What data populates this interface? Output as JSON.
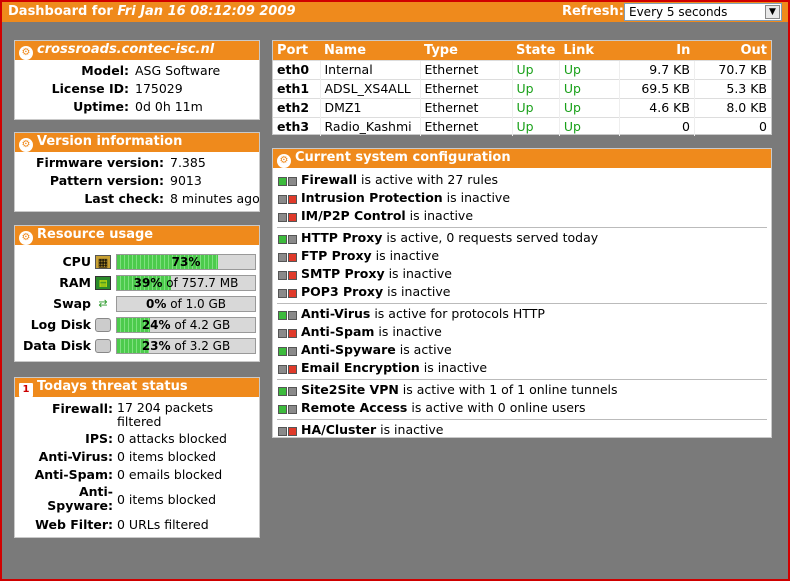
{
  "header": {
    "title_prefix": "Dashboard for",
    "title_date": "Fri Jan 16 08:12:09 2009",
    "refresh_label": "Refresh:",
    "refresh_value": "Every 5 seconds"
  },
  "host": {
    "name": "crossroads.contec-isc.nl",
    "rows": [
      {
        "k": "Model:",
        "v": "ASG Software"
      },
      {
        "k": "License ID:",
        "v": "175029"
      },
      {
        "k": "Uptime:",
        "v": "0d 0h 11m"
      }
    ]
  },
  "version": {
    "title": "Version information",
    "rows": [
      {
        "k": "Firmware version:",
        "v": "7.385"
      },
      {
        "k": "Pattern version:",
        "v": "9013"
      },
      {
        "k": "Last check:",
        "v": "8 minutes ago"
      }
    ]
  },
  "resources": {
    "title": "Resource usage",
    "rows": [
      {
        "k": "CPU",
        "icon": "cpu-icon",
        "pct": 73,
        "label_pct": "73%",
        "label_of": ""
      },
      {
        "k": "RAM",
        "icon": "ram-icon",
        "pct": 39,
        "label_pct": "39%",
        "label_of": " of 757.7 MB"
      },
      {
        "k": "Swap",
        "icon": "swap-icon",
        "pct": 0,
        "label_pct": "0%",
        "label_of": " of 1.0 GB"
      },
      {
        "k": "Log Disk",
        "icon": "disk-icon",
        "pct": 24,
        "label_pct": "24%",
        "label_of": " of 4.2 GB"
      },
      {
        "k": "Data Disk",
        "icon": "disk-icon",
        "pct": 23,
        "label_pct": "23%",
        "label_of": " of 3.2 GB"
      }
    ]
  },
  "threats": {
    "title": "Todays threat status",
    "calendar_day": "1",
    "rows": [
      {
        "k": "Firewall:",
        "v": "17 204 packets filtered"
      },
      {
        "k": "IPS:",
        "v": "0 attacks blocked"
      },
      {
        "k": "Anti-Virus:",
        "v": "0 items blocked"
      },
      {
        "k": "Anti-Spam:",
        "v": "0 emails blocked"
      },
      {
        "k": "Anti-Spyware:",
        "v": "0 items blocked"
      },
      {
        "k": "Web Filter:",
        "v": "0 URLs filtered"
      }
    ]
  },
  "ports": {
    "columns": [
      "Port",
      "Name",
      "Type",
      "State",
      "Link",
      "In",
      "Out"
    ],
    "rows": [
      [
        "eth0",
        "Internal",
        "Ethernet",
        "Up",
        "Up",
        "9.7 KB",
        "70.7 KB"
      ],
      [
        "eth1",
        "ADSL_XS4ALL",
        "Ethernet",
        "Up",
        "Up",
        "69.5 KB",
        "5.3 KB"
      ],
      [
        "eth2",
        "DMZ1",
        "Ethernet",
        "Up",
        "Up",
        "4.6 KB",
        "8.0 KB"
      ],
      [
        "eth3",
        "Radio_Kashmi",
        "Ethernet",
        "Up",
        "Up",
        "0",
        "0"
      ]
    ]
  },
  "config": {
    "title": "Current system configuration",
    "groups": [
      [
        {
          "name": "Firewall",
          "text": " is active with 27 rules",
          "active": true
        },
        {
          "name": "Intrusion Protection",
          "text": " is inactive",
          "active": false
        },
        {
          "name": "IM/P2P Control",
          "text": " is inactive",
          "active": false
        }
      ],
      [
        {
          "name": "HTTP Proxy",
          "text": " is active, 0 requests served today",
          "active": true
        },
        {
          "name": "FTP Proxy",
          "text": " is inactive",
          "active": false
        },
        {
          "name": "SMTP Proxy",
          "text": " is inactive",
          "active": false
        },
        {
          "name": "POP3 Proxy",
          "text": " is inactive",
          "active": false
        }
      ],
      [
        {
          "name": "Anti-Virus",
          "text": " is active for protocols HTTP",
          "active": true
        },
        {
          "name": "Anti-Spam",
          "text": " is inactive",
          "active": false
        },
        {
          "name": "Anti-Spyware",
          "text": " is active",
          "active": true
        },
        {
          "name": "Email Encryption",
          "text": " is inactive",
          "active": false
        }
      ],
      [
        {
          "name": "Site2Site VPN",
          "text": " is active with 1 of 1 online tunnels",
          "active": true
        },
        {
          "name": "Remote Access",
          "text": " is active with 0 online users",
          "active": true
        }
      ],
      [
        {
          "name": "HA/Cluster",
          "text": " is inactive",
          "active": false
        }
      ]
    ]
  },
  "colors": {
    "accent": "#ef8a1c",
    "status_up": "#19a019",
    "led_on": "#3dbb3d",
    "led_off": "#e03a2a"
  }
}
